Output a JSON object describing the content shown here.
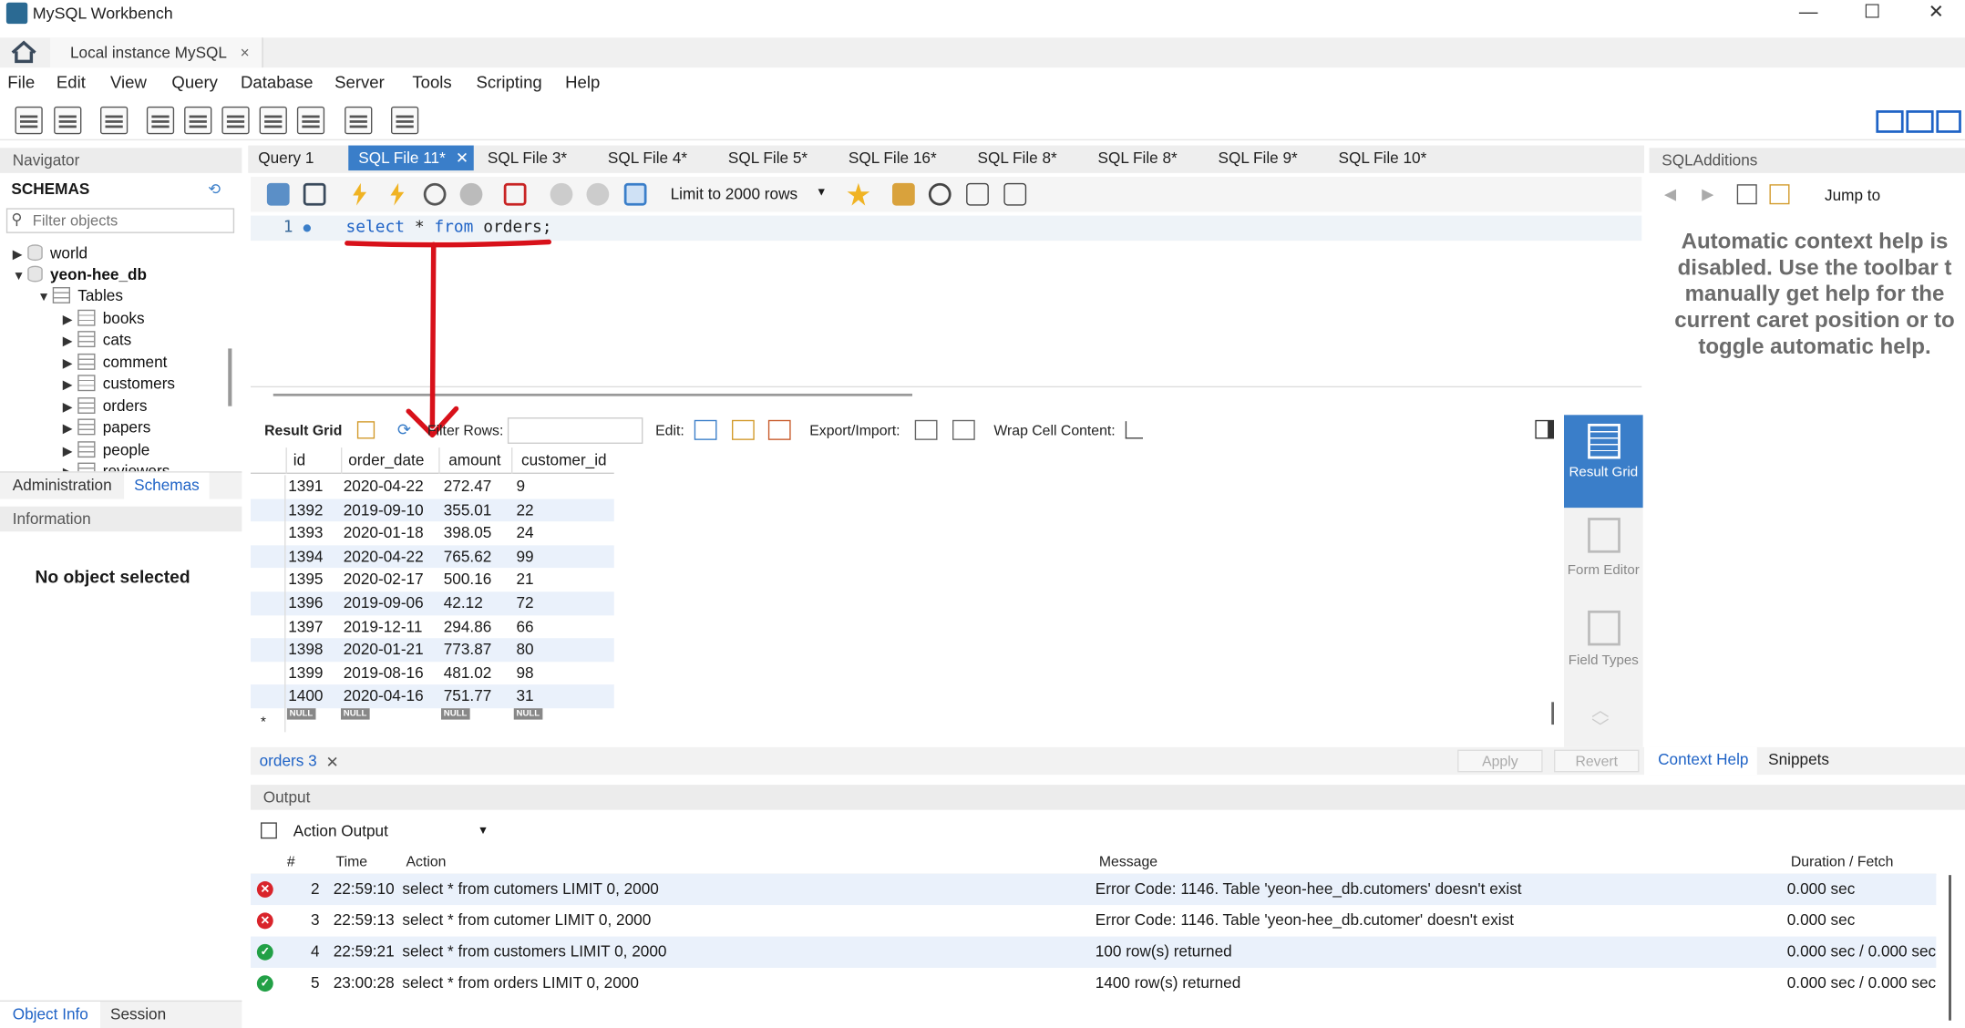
{
  "window": {
    "title": "MySQL Workbench",
    "minimize": "—",
    "maximize": "☐",
    "close": "✕"
  },
  "connection_tab": {
    "label": "Local instance MySQL",
    "close": "×"
  },
  "menu": [
    "File",
    "Edit",
    "View",
    "Query",
    "Database",
    "Server",
    "Tools",
    "Scripting",
    "Help"
  ],
  "navigator": {
    "header": "Navigator",
    "schemas_label": "SCHEMAS",
    "filter_placeholder": "Filter objects",
    "tree": {
      "world": "world",
      "db": "yeon-hee_db",
      "tables_folder": "Tables",
      "tables": [
        "books",
        "cats",
        "comment",
        "customers",
        "orders",
        "papers",
        "people",
        "reviewers"
      ]
    },
    "tabs": [
      "Administration",
      "Schemas"
    ]
  },
  "information": {
    "header": "Information",
    "text": "No object selected",
    "tabs": [
      "Object Info",
      "Session"
    ]
  },
  "sql_tabs": [
    "Query 1",
    "SQL File 11*",
    "SQL File 3*",
    "SQL File 4*",
    "SQL File 5*",
    "SQL File 16*",
    "SQL File 8*",
    "SQL File 8*",
    "SQL File 9*",
    "SQL File 10*"
  ],
  "editor_toolbar": {
    "limit_label": "Limit to 2000 rows"
  },
  "editor": {
    "line_number": "1",
    "kw_select": "select",
    "star": " * ",
    "kw_from": "from",
    "rest": " orders;"
  },
  "result_toolbar": {
    "result_grid": "Result Grid",
    "filter_rows": "Filter Rows:",
    "edit": "Edit:",
    "export_import": "Export/Import:",
    "wrap": "Wrap Cell Content:"
  },
  "grid": {
    "columns": [
      "id",
      "order_date",
      "amount",
      "customer_id"
    ],
    "rows": [
      [
        "1391",
        "2020-04-22",
        "272.47",
        "9"
      ],
      [
        "1392",
        "2019-09-10",
        "355.01",
        "22"
      ],
      [
        "1393",
        "2020-01-18",
        "398.05",
        "24"
      ],
      [
        "1394",
        "2020-04-22",
        "765.62",
        "99"
      ],
      [
        "1395",
        "2020-02-17",
        "500.16",
        "21"
      ],
      [
        "1396",
        "2019-09-06",
        "42.12",
        "72"
      ],
      [
        "1397",
        "2019-12-11",
        "294.86",
        "66"
      ],
      [
        "1398",
        "2020-01-21",
        "773.87",
        "80"
      ],
      [
        "1399",
        "2019-08-16",
        "481.02",
        "98"
      ],
      [
        "1400",
        "2020-04-16",
        "751.77",
        "31"
      ]
    ],
    "null_label": "NULL",
    "new_row_marker": "*"
  },
  "side_nav": {
    "result_grid": "Result Grid",
    "form_editor": "Form Editor",
    "field_types": "Field Types"
  },
  "result_tabs": {
    "tab": "orders 3",
    "apply": "Apply",
    "revert": "Revert"
  },
  "sql_additions": {
    "header": "SQLAdditions",
    "jump_to": "Jump to",
    "help_text": "Automatic context help is disabled. Use the toolbar t manually get help for the current caret position or to toggle automatic help.",
    "tabs": [
      "Context Help",
      "Snippets"
    ]
  },
  "output": {
    "header": "Output",
    "selector": "Action Output",
    "columns": [
      "#",
      "Time",
      "Action",
      "Message",
      "Duration / Fetch"
    ],
    "rows": [
      {
        "status": "error",
        "num": "2",
        "time": "22:59:10",
        "action": "select * from cutomers LIMIT 0, 2000",
        "message": "Error Code: 1146. Table 'yeon-hee_db.cutomers' doesn't exist",
        "duration": "0.000 sec"
      },
      {
        "status": "error",
        "num": "3",
        "time": "22:59:13",
        "action": "select * from cutomer LIMIT 0, 2000",
        "message": "Error Code: 1146. Table 'yeon-hee_db.cutomer' doesn't exist",
        "duration": "0.000 sec"
      },
      {
        "status": "ok",
        "num": "4",
        "time": "22:59:21",
        "action": "select * from customers LIMIT 0, 2000",
        "message": "100 row(s) returned",
        "duration": "0.000 sec / 0.000 sec"
      },
      {
        "status": "ok",
        "num": "5",
        "time": "23:00:28",
        "action": "select * from orders LIMIT 0, 2000",
        "message": "1400 row(s) returned",
        "duration": "0.000 sec / 0.000 sec"
      }
    ]
  },
  "annotation_color": "#d8111a"
}
